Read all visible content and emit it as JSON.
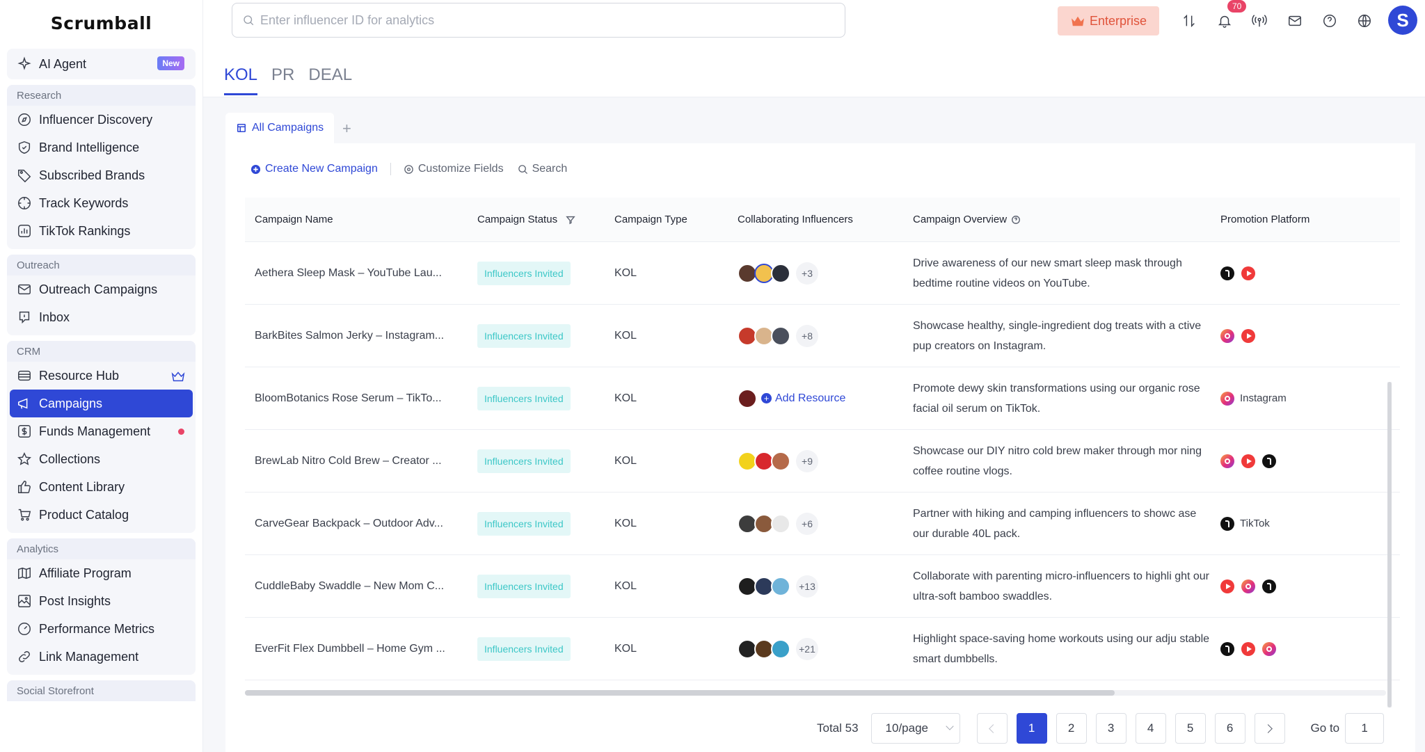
{
  "app": {
    "logo": "Scrumball"
  },
  "sidebar": {
    "ai_agent": {
      "label": "AI Agent",
      "badge": "New"
    },
    "groups": [
      {
        "title": "Research",
        "items": [
          "Influencer Discovery",
          "Brand Intelligence",
          "Subscribed Brands",
          "Track Keywords",
          "TikTok Rankings"
        ]
      },
      {
        "title": "Outreach",
        "items": [
          "Outreach Campaigns",
          "Inbox"
        ]
      },
      {
        "title": "CRM",
        "items": [
          "Resource Hub",
          "Campaigns",
          "Funds Management",
          "Collections",
          "Content Library",
          "Product Catalog"
        ]
      },
      {
        "title": "Analytics",
        "items": [
          "Affiliate Program",
          "Post Insights",
          "Performance Metrics",
          "Link Management"
        ]
      },
      {
        "title": "Social Storefront",
        "items": []
      }
    ],
    "active_item": "Campaigns"
  },
  "topbar": {
    "search_placeholder": "Enter influencer ID for analytics",
    "enterprise_label": "Enterprise",
    "notification_count": "70",
    "avatar_letter": "S"
  },
  "tabs": {
    "main": [
      "KOL",
      "PR",
      "DEAL"
    ],
    "active": "KOL",
    "sub_tab": "All Campaigns",
    "add_tab": "+"
  },
  "toolbar": {
    "create": "Create New Campaign",
    "customize": "Customize Fields",
    "search": "Search"
  },
  "table": {
    "headers": [
      "Campaign Name",
      "Campaign Status",
      "Campaign Type",
      "Collaborating Influencers",
      "Campaign Overview",
      "Promotion Platform"
    ],
    "rows": [
      {
        "name": "Aethera Sleep Mask – YouTube Lau...",
        "status": "Influencers Invited",
        "type": "KOL",
        "more": "+3",
        "overview": "Drive awareness of our new smart sleep mask through bedtime routine videos on YouTube.",
        "platforms": [
          "tiktok",
          "youtube"
        ],
        "platform_label": ""
      },
      {
        "name": "BarkBites Salmon Jerky – Instagram...",
        "status": "Influencers Invited",
        "type": "KOL",
        "more": "+8",
        "overview": "Showcase healthy, single-ingredient dog treats with a ctive pup creators on Instagram.",
        "platforms": [
          "instagram",
          "youtube"
        ],
        "platform_label": ""
      },
      {
        "name": "BloomBotanics Rose Serum – TikTo...",
        "status": "Influencers Invited",
        "type": "KOL",
        "more": "",
        "add_resource": "Add Resource",
        "overview": "Promote dewy skin transformations using our organic rose facial oil serum on TikTok.",
        "platforms": [
          "instagram"
        ],
        "platform_label": "Instagram"
      },
      {
        "name": "BrewLab Nitro Cold Brew – Creator ...",
        "status": "Influencers Invited",
        "type": "KOL",
        "more": "+9",
        "overview": "Showcase our DIY nitro cold brew maker through mor ning coffee routine vlogs.",
        "platforms": [
          "instagram",
          "youtube",
          "tiktok"
        ],
        "platform_label": ""
      },
      {
        "name": "CarveGear Backpack – Outdoor Adv...",
        "status": "Influencers Invited",
        "type": "KOL",
        "more": "+6",
        "overview": "Partner with hiking and camping influencers to showc ase our durable 40L pack.",
        "platforms": [
          "tiktok"
        ],
        "platform_label": "TikTok"
      },
      {
        "name": "CuddleBaby Swaddle – New Mom C...",
        "status": "Influencers Invited",
        "type": "KOL",
        "more": "+13",
        "overview": "Collaborate with parenting micro-influencers to highli ght our ultra-soft bamboo swaddles.",
        "platforms": [
          "youtube",
          "instagram",
          "tiktok"
        ],
        "platform_label": ""
      },
      {
        "name": "EverFit Flex Dumbbell – Home Gym ...",
        "status": "Influencers Invited",
        "type": "KOL",
        "more": "+21",
        "overview": "Highlight space-saving home workouts using our adju stable smart dumbbells.",
        "platforms": [
          "tiktok",
          "youtube",
          "instagram"
        ],
        "platform_label": ""
      }
    ]
  },
  "pagination": {
    "total": "Total 53",
    "per_page": "10/page",
    "pages": [
      "1",
      "2",
      "3",
      "4",
      "5",
      "6"
    ],
    "current": "1",
    "goto_label": "Go to",
    "goto_value": "1"
  },
  "colors": {
    "accent": "#2f48d6",
    "status_text": "#3cc7c7",
    "status_bg": "#e3f7f7",
    "enterprise_bg": "#fbd6cf",
    "badge_red": "#e94467"
  }
}
